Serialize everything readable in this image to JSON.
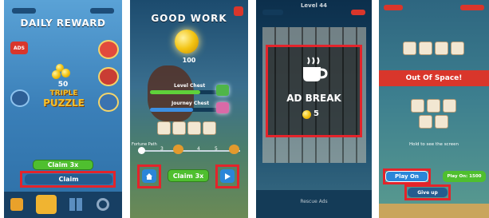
{
  "panels": {
    "daily_reward": {
      "title": "DAILY REWARD",
      "coin_amount": "50",
      "logo_line1": "TRIPLE",
      "logo_line2": "PUZZLE",
      "claim_x3_label": "Claim 3x",
      "claim_label": "Claim"
    },
    "good_work": {
      "title": "GOOD WORK",
      "coin_amount": "100",
      "level_chest_label": "Level Chest",
      "journey_chest_label": "Journey Chest",
      "fortune_path_label": "Fortune Path",
      "claim_x3_label": "Claim 3x",
      "path_numbers": [
        "3",
        "4",
        "5"
      ]
    },
    "ad_break": {
      "level_label": "Level 44",
      "title": "AD BREAK",
      "amount": "5",
      "bottom_label": "Rescue Ads"
    },
    "out_of_space": {
      "title": "Out Of Space!",
      "hold_text": "Hold to see the screen",
      "play_on_label": "Play On",
      "play_on_cost": "Play On: 1500",
      "give_up_label": "Give up"
    }
  },
  "colors": {
    "highlight": "#e3242b",
    "claim_green": "#4fbf2f",
    "banner_red": "#d9362b",
    "blue_button": "#2b86d8",
    "coin_gold": "#f3c414"
  },
  "icons": [
    "home-icon",
    "play-arrow-icon",
    "coffee-cup-icon",
    "coin-icon",
    "grid-icon",
    "gear-icon",
    "shop-icon"
  ]
}
